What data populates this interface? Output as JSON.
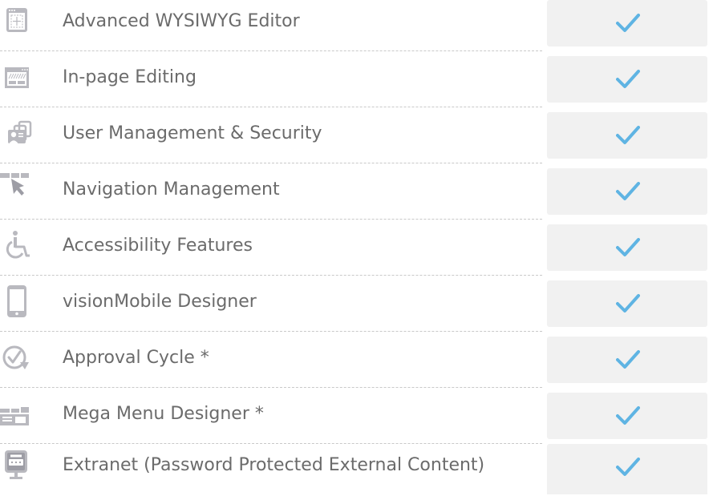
{
  "colors": {
    "label": "#6b6b6b",
    "icon": "#b9b9bf",
    "icon_dark": "#9d9da5",
    "cell": "#f1f1f1",
    "check": "#5fb4e3",
    "divider": "#c9c9c9"
  },
  "features": [
    {
      "label": "Advanced WYSIWYG Editor",
      "icon": "wysiwyg-editor-icon",
      "included": true
    },
    {
      "label": "In-page Editing",
      "icon": "in-page-editing-icon",
      "included": true
    },
    {
      "label": "User Management & Security",
      "icon": "user-management-icon",
      "included": true
    },
    {
      "label": "Navigation Management",
      "icon": "navigation-cursor-icon",
      "included": true
    },
    {
      "label": "Accessibility Features",
      "icon": "wheelchair-icon",
      "included": true
    },
    {
      "label": "visionMobile Designer",
      "icon": "mobile-phone-icon",
      "included": true
    },
    {
      "label": "Approval Cycle *",
      "icon": "approval-cycle-icon",
      "included": true
    },
    {
      "label": "Mega Menu Designer *",
      "icon": "mega-menu-icon",
      "included": true
    },
    {
      "label": "Extranet (Password Protected External Content)",
      "icon": "login-screen-icon",
      "included": true
    }
  ]
}
